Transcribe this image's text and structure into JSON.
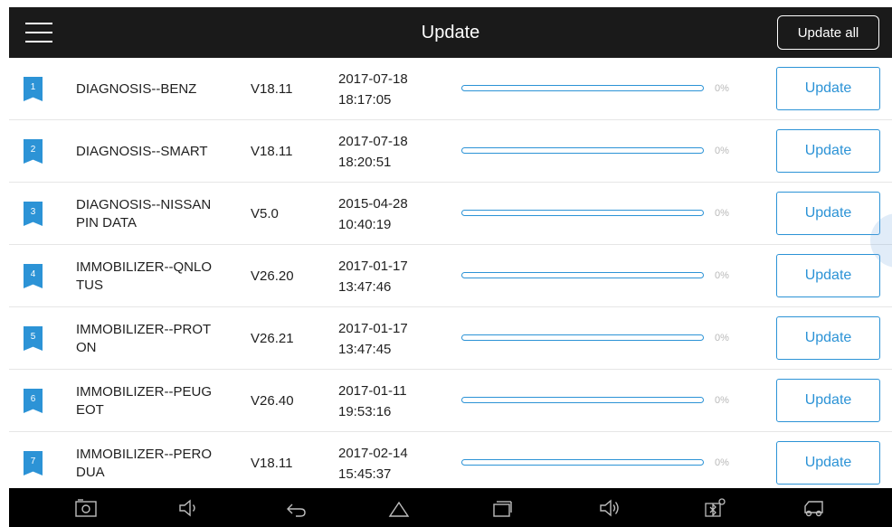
{
  "header": {
    "title": "Update",
    "update_all_label": "Update all"
  },
  "list": {
    "update_label": "Update",
    "items": [
      {
        "index": "1",
        "name_line1": "DIAGNOSIS--BENZ",
        "name_line2": "",
        "version": "V18.11",
        "date": "2017-07-18",
        "time": "18:17:05",
        "progress_percent": 0,
        "percent_label": "0%"
      },
      {
        "index": "2",
        "name_line1": "DIAGNOSIS--SMART",
        "name_line2": "",
        "version": "V18.11",
        "date": "2017-07-18",
        "time": "18:20:51",
        "progress_percent": 0,
        "percent_label": "0%"
      },
      {
        "index": "3",
        "name_line1": "DIAGNOSIS--NISSAN",
        "name_line2": "PIN DATA",
        "version": "V5.0",
        "date": "2015-04-28",
        "time": "10:40:19",
        "progress_percent": 0,
        "percent_label": "0%"
      },
      {
        "index": "4",
        "name_line1": "IMMOBILIZER--QNLO",
        "name_line2": "TUS",
        "version": "V26.20",
        "date": "2017-01-17",
        "time": "13:47:46",
        "progress_percent": 0,
        "percent_label": "0%"
      },
      {
        "index": "5",
        "name_line1": "IMMOBILIZER--PROT",
        "name_line2": "ON",
        "version": "V26.21",
        "date": "2017-01-17",
        "time": "13:47:45",
        "progress_percent": 0,
        "percent_label": "0%"
      },
      {
        "index": "6",
        "name_line1": "IMMOBILIZER--PEUG",
        "name_line2": "EOT",
        "version": "V26.40",
        "date": "2017-01-11",
        "time": "19:53:16",
        "progress_percent": 0,
        "percent_label": "0%"
      },
      {
        "index": "7",
        "name_line1": "IMMOBILIZER--PERO",
        "name_line2": "DUA",
        "version": "V18.11",
        "date": "2017-02-14",
        "time": "15:45:37",
        "progress_percent": 0,
        "percent_label": "0%"
      }
    ]
  },
  "navbar": {
    "icons": [
      "screenshot-icon",
      "volume-down-icon",
      "back-icon",
      "home-icon",
      "recent-apps-icon",
      "volume-up-icon",
      "vci-bluetooth-icon",
      "vehicle-connect-icon"
    ]
  },
  "colors": {
    "accent": "#2c93d6",
    "topbar": "#1a1a1a",
    "navbar": "#000000",
    "percent_text": "#b9b9b9",
    "divider": "#e6e6e6"
  }
}
